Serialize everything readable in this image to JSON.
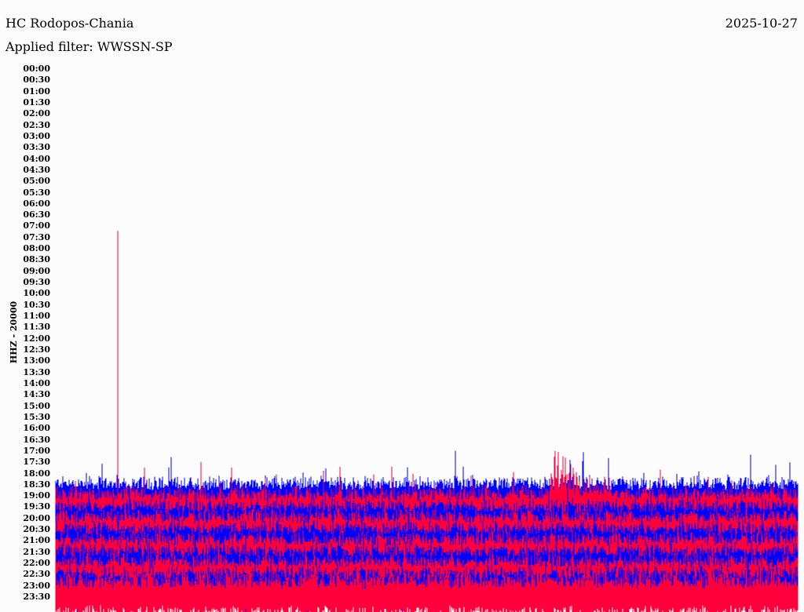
{
  "header": {
    "station": "HC Rodopos-Chania",
    "date": "2025-10-27",
    "filter": "Applied filter: WWSSN-SP"
  },
  "chart_data": {
    "type": "line",
    "title": "HC Rodopos-Chania",
    "ylabel": "HHZ - 20000",
    "xlabel": "",
    "row_interval_minutes": 30,
    "row_labels": [
      "00:00",
      "00:30",
      "01:00",
      "01:30",
      "02:00",
      "02:30",
      "03:00",
      "03:30",
      "04:00",
      "04:30",
      "05:00",
      "05:30",
      "06:00",
      "06:30",
      "07:00",
      "07:30",
      "08:00",
      "08:30",
      "09:00",
      "09:30",
      "10:00",
      "10:30",
      "11:00",
      "11:30",
      "12:00",
      "12:30",
      "13:00",
      "13:30",
      "14:00",
      "14:30",
      "15:00",
      "15:30",
      "16:00",
      "16:30",
      "17:00",
      "17:30",
      "18:00",
      "18:30",
      "19:00",
      "19:30",
      "20:00",
      "20:30",
      "21:00",
      "21:30",
      "22:00",
      "22:30",
      "23:00",
      "23:30"
    ],
    "trace_colors": [
      "#0000ff",
      "#ff003c"
    ],
    "series": [
      {
        "row": "19:00",
        "color": "#0000ff",
        "base_amplitude": 1.6
      },
      {
        "row": "19:30",
        "color": "#ff003c",
        "base_amplitude": 1.7
      },
      {
        "row": "20:00",
        "color": "#0000ff",
        "base_amplitude": 1.6
      },
      {
        "row": "20:30",
        "color": "#ff003c",
        "base_amplitude": 1.7
      },
      {
        "row": "21:00",
        "color": "#0000ff",
        "base_amplitude": 1.6
      },
      {
        "row": "21:30",
        "color": "#ff003c",
        "base_amplitude": 1.7
      },
      {
        "row": "22:00",
        "color": "#0000ff",
        "base_amplitude": 1.6
      },
      {
        "row": "22:30",
        "color": "#ff003c",
        "base_amplitude": 1.7
      },
      {
        "row": "23:00",
        "color": "#0000ff",
        "base_amplitude": 1.6
      },
      {
        "row": "23:30",
        "color": "#ff003c",
        "base_amplitude": 2.2
      }
    ],
    "events": [
      {
        "row": "19:30",
        "minute": 2.5,
        "peak_amplitude": 25,
        "color": "#ff003c"
      },
      {
        "row": "19:30",
        "minute": 20,
        "peak_amplitude": 11,
        "color": "#ff003c",
        "duration_minutes": 3
      }
    ]
  }
}
